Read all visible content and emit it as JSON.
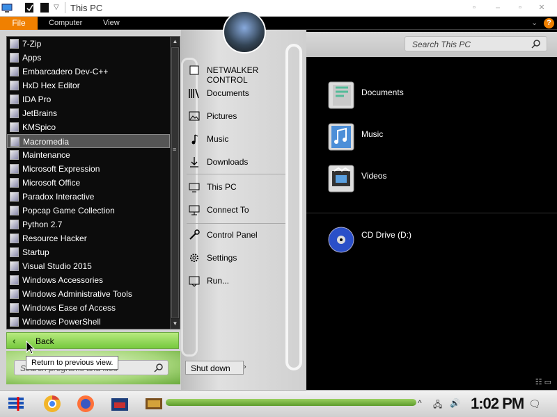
{
  "window": {
    "title": "This PC"
  },
  "ribbon": {
    "tabs": [
      "File",
      "Computer",
      "View"
    ]
  },
  "search": {
    "placeholder": "Search This PC"
  },
  "content": {
    "folders": [
      "Documents",
      "Music",
      "Videos"
    ],
    "drives": [
      "CD Drive (D:)"
    ]
  },
  "start_menu": {
    "programs": [
      "7-Zip",
      "Apps",
      "Embarcadero Dev-C++",
      "HxD Hex Editor",
      "IDA Pro",
      "JetBrains",
      "KMSpico",
      "Macromedia",
      "Maintenance",
      "Microsoft Expression",
      "Microsoft Office",
      "Paradox Interactive",
      "Popcap Game Collection",
      "Python 2.7",
      "Resource Hacker",
      "Startup",
      "Visual Studio 2015",
      "Windows Accessories",
      "Windows Administrative Tools",
      "Windows Ease of Access",
      "Windows PowerShell"
    ],
    "selected_program": "Macromedia",
    "back_label": "Back",
    "tooltip": "Return to previous view.",
    "search_placeholder": "Search programs and files",
    "places": {
      "user": "NETWALKER CONTROL",
      "documents": "Documents",
      "pictures": "Pictures",
      "music": "Music",
      "downloads": "Downloads",
      "this_pc": "This PC",
      "connect_to": "Connect To",
      "control_panel": "Control Panel",
      "settings": "Settings",
      "run": "Run..."
    },
    "shutdown_label": "Shut down"
  },
  "taskbar": {
    "clock": "1:02 PM"
  },
  "colors": {
    "accent_orange": "#f08000",
    "accent_green": "#7ccc44"
  }
}
